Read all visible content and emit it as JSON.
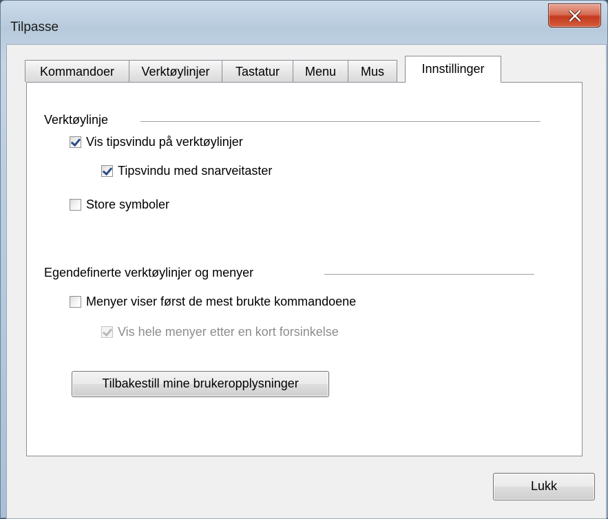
{
  "window": {
    "title": "Tilpasse"
  },
  "tabs": [
    {
      "label": "Kommandoer",
      "active": false
    },
    {
      "label": "Verktøylinjer",
      "active": false
    },
    {
      "label": "Tastatur",
      "active": false
    },
    {
      "label": "Menu",
      "active": false
    },
    {
      "label": "Mus",
      "active": false
    },
    {
      "label": "Innstillinger",
      "active": true
    }
  ],
  "toolbar_group": {
    "heading": "Verktøylinje",
    "show_tooltips": {
      "label": "Vis tipsvindu på verktøylinjer",
      "checked": true
    },
    "tooltips_shortcuts": {
      "label": "Tipsvindu med snarveitaster",
      "checked": true
    },
    "large_icons": {
      "label": "Store symboler",
      "checked": false
    }
  },
  "custom_group": {
    "heading": "Egendefinerte verktøylinjer og menyer",
    "recent_commands_first": {
      "label": "Menyer viser først de mest brukte kommandoene",
      "checked": false
    },
    "full_menus_delay": {
      "label": "Vis hele menyer etter en kort forsinkelse",
      "checked": true,
      "disabled": true
    },
    "reset_button": "Tilbakestill mine brukeropplysninger"
  },
  "footer": {
    "close_button": "Lukk"
  },
  "colors": {
    "accent_close": "#c43a1e",
    "checkmark": "#2a4d86",
    "disabled_text": "#8d8d8d"
  },
  "icons": {
    "close": "close-x-icon",
    "check": "checkmark-icon"
  }
}
